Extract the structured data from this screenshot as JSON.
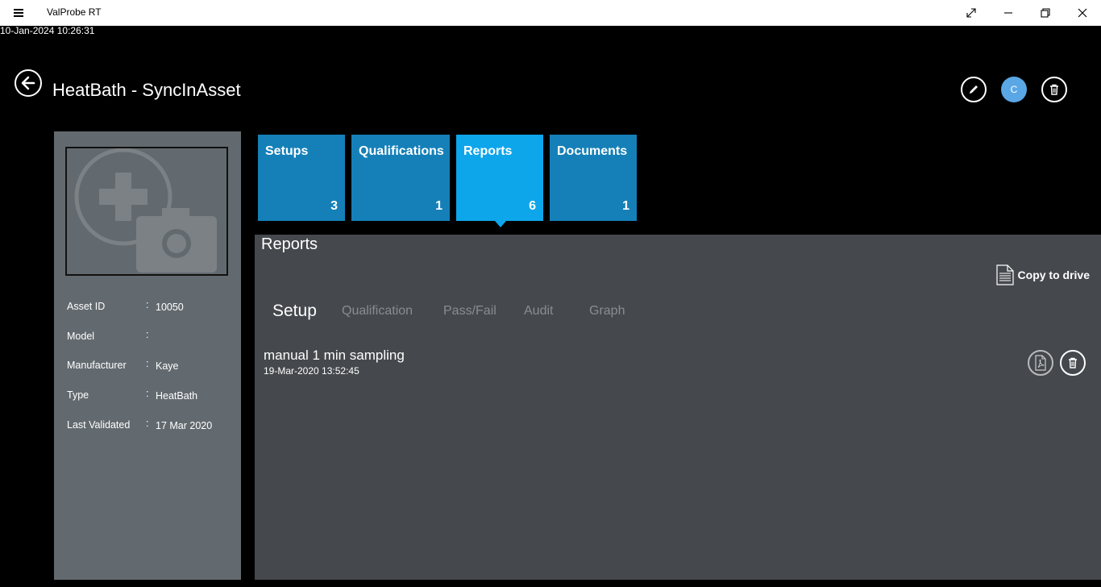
{
  "window": {
    "app_title": "ValProbe RT",
    "icons": {
      "menu": "hamburger-icon",
      "fullscreen": "expand-icon",
      "minimize": "minimize-icon",
      "maximize": "restore-icon",
      "close": "close-icon"
    }
  },
  "timestamp": "10-Jan-2024 10:26:31",
  "header": {
    "title": "HeatBath - SyncInAsset",
    "avatar_initial": "C"
  },
  "asset": {
    "fields": [
      {
        "label": "Asset ID",
        "value": "10050"
      },
      {
        "label": "Model",
        "value": ""
      },
      {
        "label": "Manufacturer",
        "value": "Kaye"
      },
      {
        "label": "Type",
        "value": "HeatBath"
      },
      {
        "label": "Last Validated",
        "value": "17 Mar 2020"
      }
    ]
  },
  "tiles": [
    {
      "label": "Setups",
      "count": "3"
    },
    {
      "label": "Qualifications",
      "count": "1"
    },
    {
      "label": "Reports",
      "count": "6",
      "active": true
    },
    {
      "label": "Documents",
      "count": "1"
    }
  ],
  "reports": {
    "title": "Reports",
    "copy_label": "Copy to drive",
    "subtabs": [
      "Setup",
      "Qualification",
      "Pass/Fail",
      "Audit",
      "Graph"
    ],
    "active_subtab": "Setup",
    "items": [
      {
        "name": "manual 1 min sampling",
        "date": "19-Mar-2020 13:52:45"
      }
    ]
  },
  "colors": {
    "tile": "#1580b8",
    "tile_active": "#0ea6eb",
    "left_panel": "#636a6f",
    "main_panel": "#45484c",
    "avatar": "#5aa7e6"
  }
}
